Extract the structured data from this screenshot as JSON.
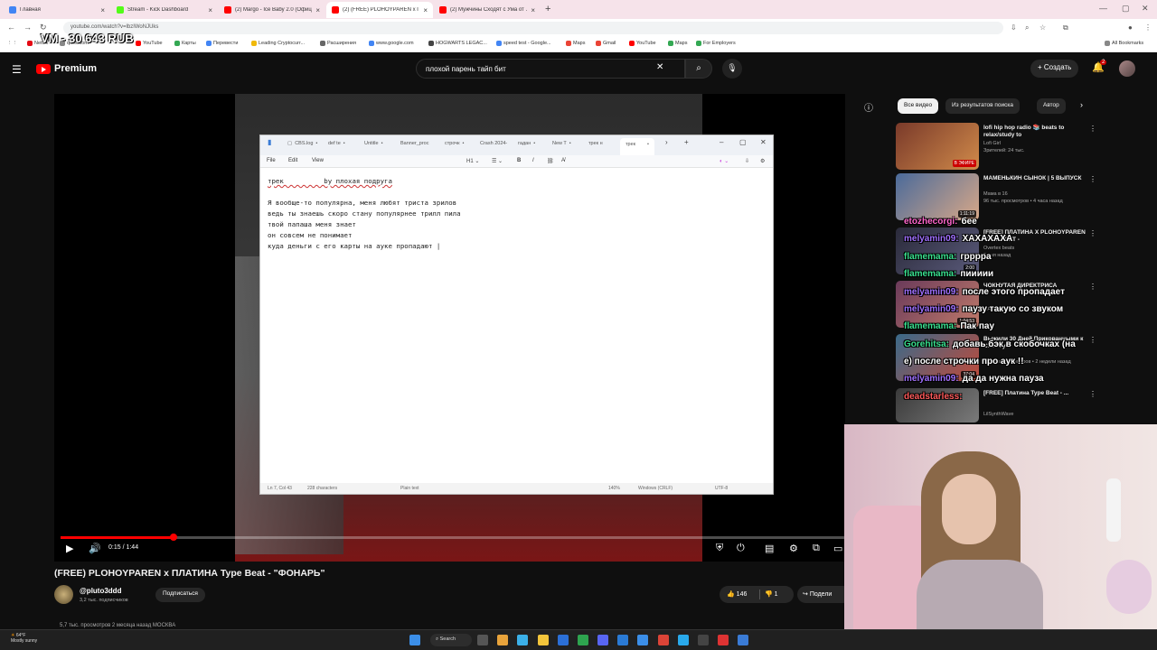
{
  "browser": {
    "tabs": [
      {
        "label": "Главная",
        "color": "#4285f4",
        "active": false
      },
      {
        "label": "Stream - Kick Dashboard",
        "color": "#53fc18",
        "active": false
      },
      {
        "label": "(2) Margo - Ice Baby 2.0 (Офиц...",
        "color": "#ff0000",
        "active": false
      },
      {
        "label": "(2) (FREE) PLOHOYPAREN x ПЛАТИ...",
        "color": "#ff0000",
        "active": true
      },
      {
        "label": "(2) Мужчины Сходят с Ума от ...",
        "color": "#ff0000",
        "active": false
      }
    ],
    "url": "youtube.com/watch?v=lbzIWoNJUks",
    "bookmarks": [
      "Netflix",
      "questcom",
      "YouTube",
      "Карты",
      "Перевести",
      "Leading Cryptocurr...",
      "Расширения",
      "www.google.com",
      "HOGWARTS LEGAC...",
      "speed test - Google...",
      "Maps",
      "Gmail",
      "YouTube",
      "Maps",
      "For Employers"
    ],
    "all_bookmarks": "All Bookmarks"
  },
  "overlay_vm": "VM - 30 643 RUB",
  "youtube": {
    "logo_text": "Premium",
    "search_value": "плохой парень тайп бит",
    "create_label": "Создать",
    "notif_count": "2"
  },
  "notepad": {
    "tabs": [
      "CBS.log",
      "def te",
      "Untitle",
      "Banner_proc",
      "строчк",
      "Crash 2024-",
      "гадан",
      "New T",
      "трек н",
      "трек"
    ],
    "menu": [
      "File",
      "Edit",
      "View"
    ],
    "heading_level": "H1",
    "lines": [
      "трек          by плохая подруга",
      "",
      "Я вообще-то популярна, меня любят триста зрилов",
      "ведь ты знаешь скоро стану популярнее трилл пила",
      "твой папаша меня знает",
      "он совсем не понимает",
      "куда деньги с его карты на ауке пропадают |"
    ],
    "status": {
      "position": "Ln 7, Col 43",
      "chars": "228 characters",
      "format": "Plain text",
      "zoom": "140%",
      "eol": "Windows (CRLF)",
      "encoding": "UTF-8"
    }
  },
  "player": {
    "time": "0:15 / 1:44",
    "progress_fraction": 0.144
  },
  "video": {
    "title": "(FREE) PLOHOYPAREN x ПЛАТИНА Type Beat - \"ФОНАРЬ\"",
    "channel": "@pluto3ddd",
    "subs": "3,2 тыс. подписчиков",
    "subscribe": "Подписаться",
    "likes": "146",
    "dislikes": "1",
    "share": "Подели",
    "desc_peek": "5,7 тыс. просмотров  2 месяца назад  МОСКВА"
  },
  "sidebar": {
    "chips": [
      "Все видео",
      "Из результатов поиска",
      "Автор"
    ],
    "recs": [
      {
        "title": "lofi hip hop radio 📚 beats to relax/study to",
        "channel": "Lofi Girl",
        "meta": "Зрителей: 24 тыс.",
        "badge": "В ЭФИРЕ",
        "thumb": "#7a3a2a"
      },
      {
        "title": "МАМЕНЬКИН СЫНОК | 5 ВЫПУСК",
        "channel": "Мама в 16",
        "meta": "96 тыс. просмотров • 4 часа назад",
        "badge": "1:11:19",
        "thumb": "#4a6a9a"
      },
      {
        "title": "[FREE] ПЛАТИНА X PLOHOYPAREN TYPE BEAT -",
        "channel": "Overtex beats",
        "meta": "2 дня назад",
        "badge": "2:00",
        "thumb": "#2a2a3a"
      },
      {
        "title": "ЧОКНУТАЯ ДИРЕКТРИСА",
        "channel": "",
        "meta": "1 день назад",
        "badge": "1:04:53",
        "thumb": "#6a3a5a"
      },
      {
        "title": "Выжили 30 Дней Прикованными к Своему",
        "channel": "",
        "meta": "127 млн просмотров • 2 недели назад",
        "badge": "37:04",
        "thumb": "#3a6a8a"
      },
      {
        "title": "[FREE] Платина Type Beat - ...",
        "channel": "LilSynthWave",
        "meta": "",
        "badge": "",
        "thumb": "#3a3a3a"
      }
    ]
  },
  "chat": [
    {
      "user": "etozhecorgi:",
      "msg": "бее",
      "color": "#ff66cc"
    },
    {
      "user": "melyamin09:",
      "msg": "ХАХАХАХА",
      "color": "#a070ff"
    },
    {
      "user": "flamemama:",
      "msg": "грррра",
      "color": "#39e08f"
    },
    {
      "user": "flamemama:",
      "msg": "пиииии",
      "color": "#39e08f"
    },
    {
      "user": "melyamin09:",
      "msg": "после этого пропадает",
      "color": "#a070ff"
    },
    {
      "user": "melyamin09:",
      "msg": "паузу такую со звуком",
      "color": "#a070ff"
    },
    {
      "user": "flamemama:",
      "msg": "Пак пау",
      "color": "#39e08f"
    },
    {
      "user": "Gorehitsa:",
      "msg": "добавь бэк в скобочках (на",
      "color": "#39e08f"
    },
    {
      "user": "",
      "msg": "е) после строчки про аук !!",
      "color": "#ffffff"
    },
    {
      "user": "melyamin09:",
      "msg": "да да нужна пауза",
      "color": "#a070ff"
    },
    {
      "user": "deadstarless:",
      "msg": "",
      "color": "#ff5a5a"
    }
  ],
  "taskbar": {
    "weather_temp": "64°F",
    "weather_desc": "Mostly sunny",
    "search": "Search"
  }
}
